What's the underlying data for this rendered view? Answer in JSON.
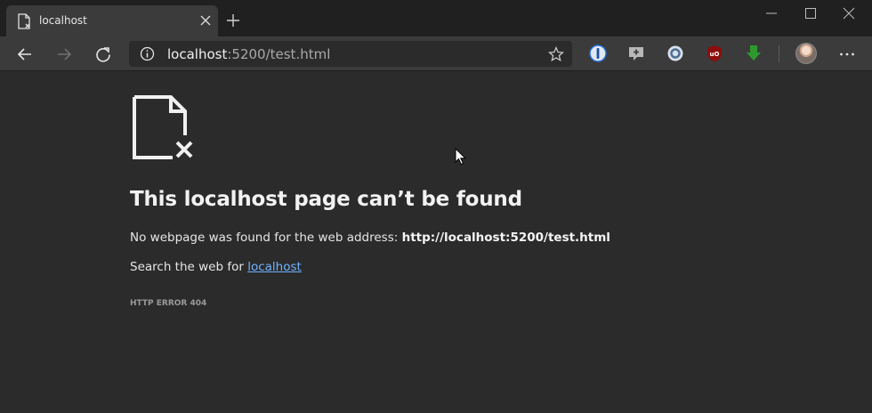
{
  "tab": {
    "title": "localhost"
  },
  "address": {
    "host": "localhost",
    "rest": ":5200/test.html"
  },
  "error": {
    "title": "This localhost page can’t be found",
    "desc_prefix": "No webpage was found for the web address: ",
    "desc_url": "http://localhost:5200/test.html",
    "search_prefix": "Search the web for ",
    "search_link": "localhost",
    "code": "HTTP ERROR 404"
  },
  "icons": {
    "back": "back-arrow-icon",
    "forward": "forward-arrow-icon",
    "refresh": "refresh-icon",
    "info": "info-icon",
    "favorite": "star-icon",
    "more": "more-icon"
  },
  "colors": {
    "page_bg": "#2b2b2b",
    "toolbar_bg": "#3b3b3b",
    "tabstrip_bg": "#202020",
    "link": "#6fb3ff"
  }
}
